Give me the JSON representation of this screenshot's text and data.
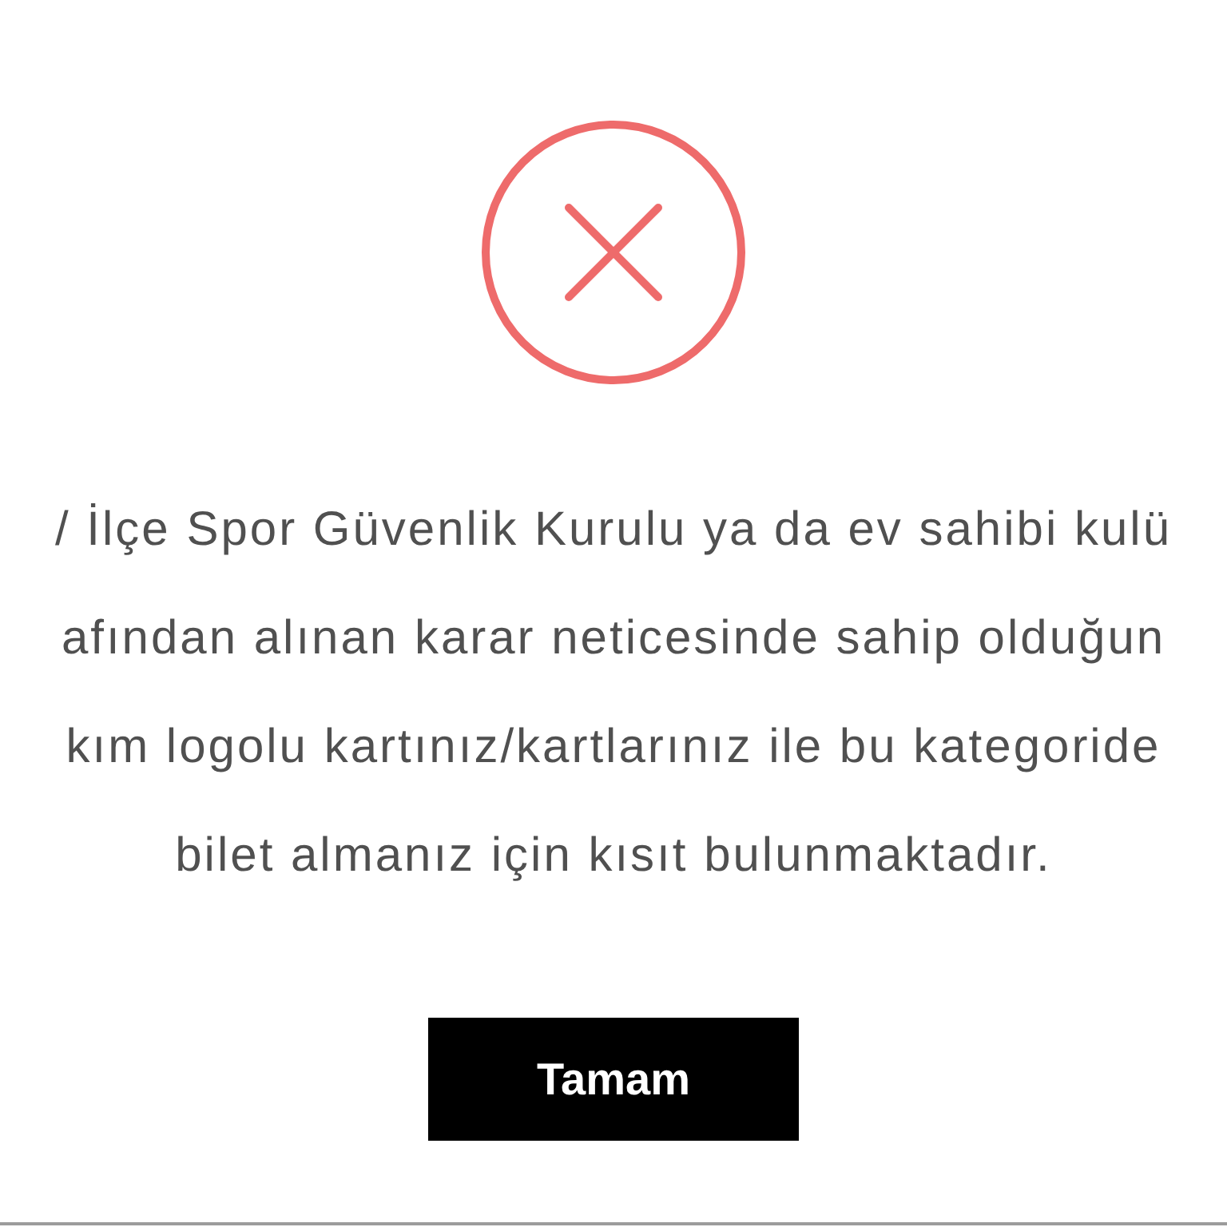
{
  "message": {
    "lines": [
      "/ İlçe Spor Güvenlik Kurulu ya da ev sahibi kulü",
      "afından alınan karar neticesinde sahip olduğun",
      "kım logolu kartınız/kartlarınız ile bu kategoride",
      "bilet almanız için kısıt bulunmaktadır."
    ]
  },
  "buttons": [
    {
      "label": "Tamam"
    }
  ]
}
